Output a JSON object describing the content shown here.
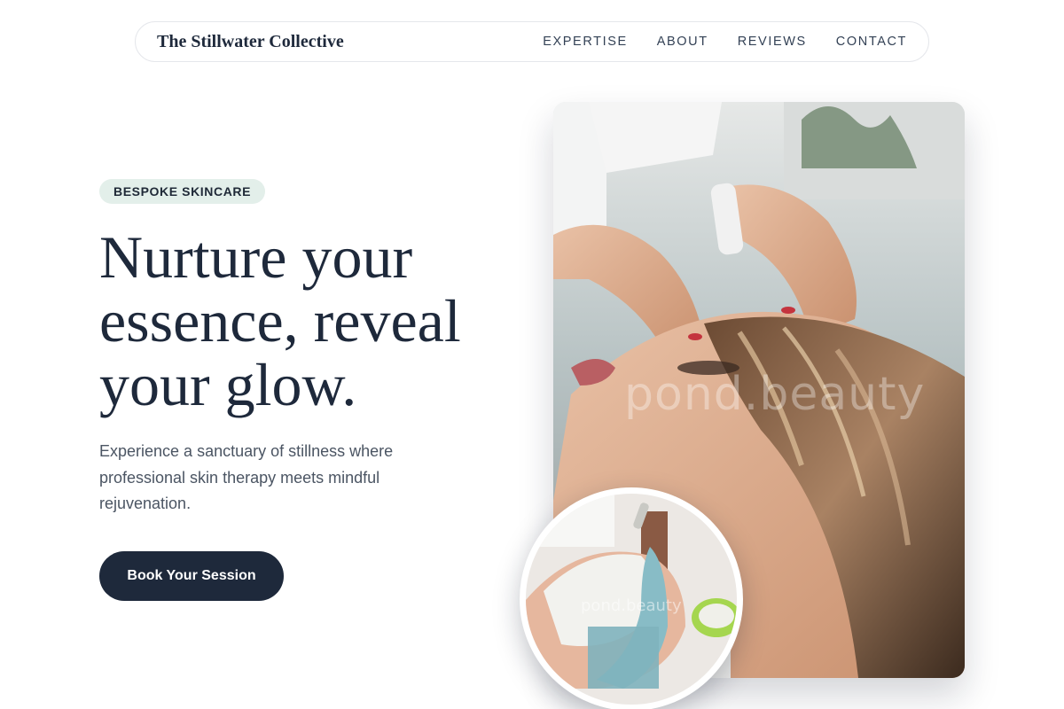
{
  "nav": {
    "brand": "The Stillwater Collective",
    "links": [
      "EXPERTISE",
      "ABOUT",
      "REVIEWS",
      "CONTACT"
    ]
  },
  "hero": {
    "badge": "BESPOKE SKINCARE",
    "headline": "Nurture your essence, reveal your glow.",
    "subtext": "Experience a sanctuary of stillness where professional skin therapy meets mindful rejuvenation.",
    "cta": "Book Your Session"
  },
  "images": {
    "main_watermark": "pond.beauty",
    "circle_watermark": "pond.beauty"
  },
  "colors": {
    "primary": "#1e293b",
    "badge_bg": "#e3efea",
    "text_muted": "#4b5563"
  }
}
